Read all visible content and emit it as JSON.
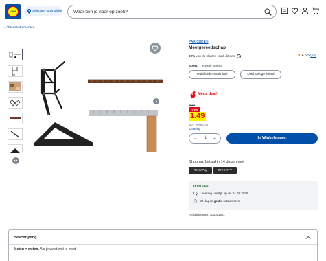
{
  "header": {
    "logo_text": "LIDL",
    "store_label": "Selecteer jouw winkel",
    "search_placeholder": "Waar ben je naar op zoek?"
  },
  "breadcrumb": {
    "prefix": "...",
    "separator": "/",
    "current": "Meetinstrumenten"
  },
  "product": {
    "brand": "PARKSIDE®",
    "title": "Meetgereedschap",
    "rating_value": "4.5/5",
    "rating_count": "(29)",
    "recommend_pct": "90%",
    "recommend_text": "van de klanten raadt dit aan",
    "variant_label": "Soort:",
    "variant_hint": "Kies je variant",
    "variants": [
      "Multihoek meetliniaal",
      "Driehoekige liniaal"
    ],
    "deal_label": "Mega deal!",
    "old_price": "6.99",
    "discount": "-79%",
    "price": "1.49",
    "tax_note": "Incl. BTW excl.",
    "delivery_link": "Levering",
    "quantity": "1",
    "cart_button": "In Winkelwagen",
    "article_number": "Artikelnummer: 100391841"
  },
  "payment": {
    "heading": "Shop nu, betaal in 14 dagen met",
    "logo1": "RevenPay",
    "logo2": "RIVERTY"
  },
  "delivery": {
    "availability": "Leverbaar",
    "line1": "Levering uiterlijk op do 24.09.2026",
    "line2_prefix": "30 dagen",
    "line2_bold": "gratis",
    "line2_suffix": "retourneren"
  },
  "description": {
    "heading": "Beschrijving",
    "intro_bold": "Meten = weten.",
    "intro_rest": "Als je weet wat je meet"
  },
  "colors": {
    "brand_blue": "#0050aa",
    "deal_red": "#e60a14",
    "price_yellow": "#fff100",
    "rating_orange": "#e38b00"
  },
  "icons": [
    "store-pin-icon",
    "search-icon",
    "receipt-icon",
    "favorites-icon",
    "account-icon",
    "cart-icon",
    "heart-icon",
    "info-icon",
    "fire-icon",
    "truck-icon",
    "return-icon",
    "chevron-up-icon",
    "chevron-down-icon",
    "chevron-right-icon"
  ]
}
